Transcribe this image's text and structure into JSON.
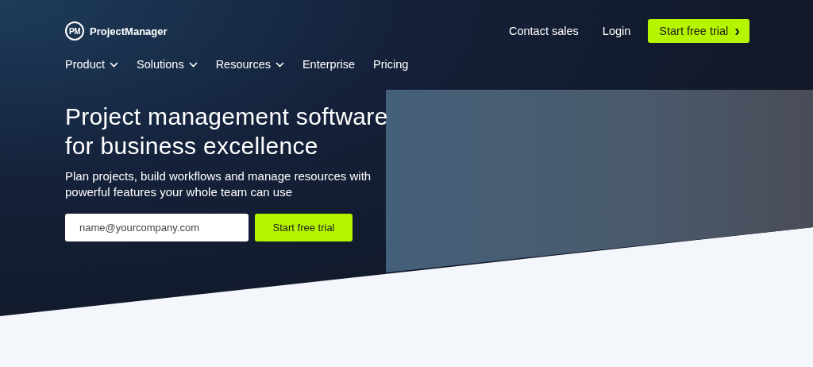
{
  "logo": {
    "mark": "PM",
    "name": "ProjectManager"
  },
  "top_links": [
    {
      "label": "Contact sales"
    },
    {
      "label": "Login"
    }
  ],
  "header_button": {
    "label": "Start free trial",
    "icon": "›"
  },
  "nav": [
    {
      "label": "Product",
      "dropdown": true
    },
    {
      "label": "Solutions",
      "dropdown": true
    },
    {
      "label": "Resources",
      "dropdown": true
    },
    {
      "label": "Enterprise",
      "dropdown": false
    },
    {
      "label": "Pricing",
      "dropdown": false
    }
  ],
  "hero": {
    "title": "Project management software for business excellence",
    "subtitle": "Plan projects, build workflows and manage resources with powerful features your whole team can use",
    "email": {
      "placeholder": "name@yourcompany.com"
    },
    "button": "Start free trial"
  }
}
